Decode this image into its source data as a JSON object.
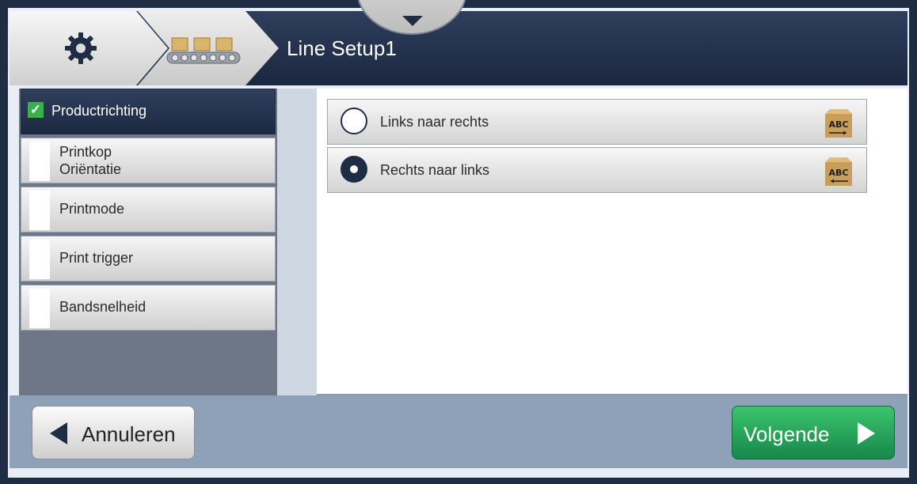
{
  "header": {
    "title": "Line Setup1",
    "breadcrumbs": [
      {
        "icon": "gear-icon"
      },
      {
        "icon": "conveyor-icon"
      }
    ]
  },
  "sidebar": {
    "items": [
      {
        "label": "Productrichting",
        "checked": true,
        "active": true
      },
      {
        "label_line1": "Printkop",
        "label_line2": "Oriëntatie",
        "checked": false
      },
      {
        "label": "Printmode",
        "checked": false
      },
      {
        "label": "Print trigger",
        "checked": false
      },
      {
        "label": "Bandsnelheid",
        "checked": false
      }
    ]
  },
  "options": [
    {
      "label": "Links naar rechts",
      "selected": false,
      "icon": "box-abc-right-arrow-icon",
      "box_text": "ABC"
    },
    {
      "label": "Rechts naar links",
      "selected": true,
      "icon": "box-abc-left-arrow-icon",
      "box_text": "ABC"
    }
  ],
  "footer": {
    "cancel_label": "Annuleren",
    "next_label": "Volgende"
  },
  "colors": {
    "header": "#1f2d44",
    "check": "#36b24a",
    "next_button": "#22a157"
  }
}
